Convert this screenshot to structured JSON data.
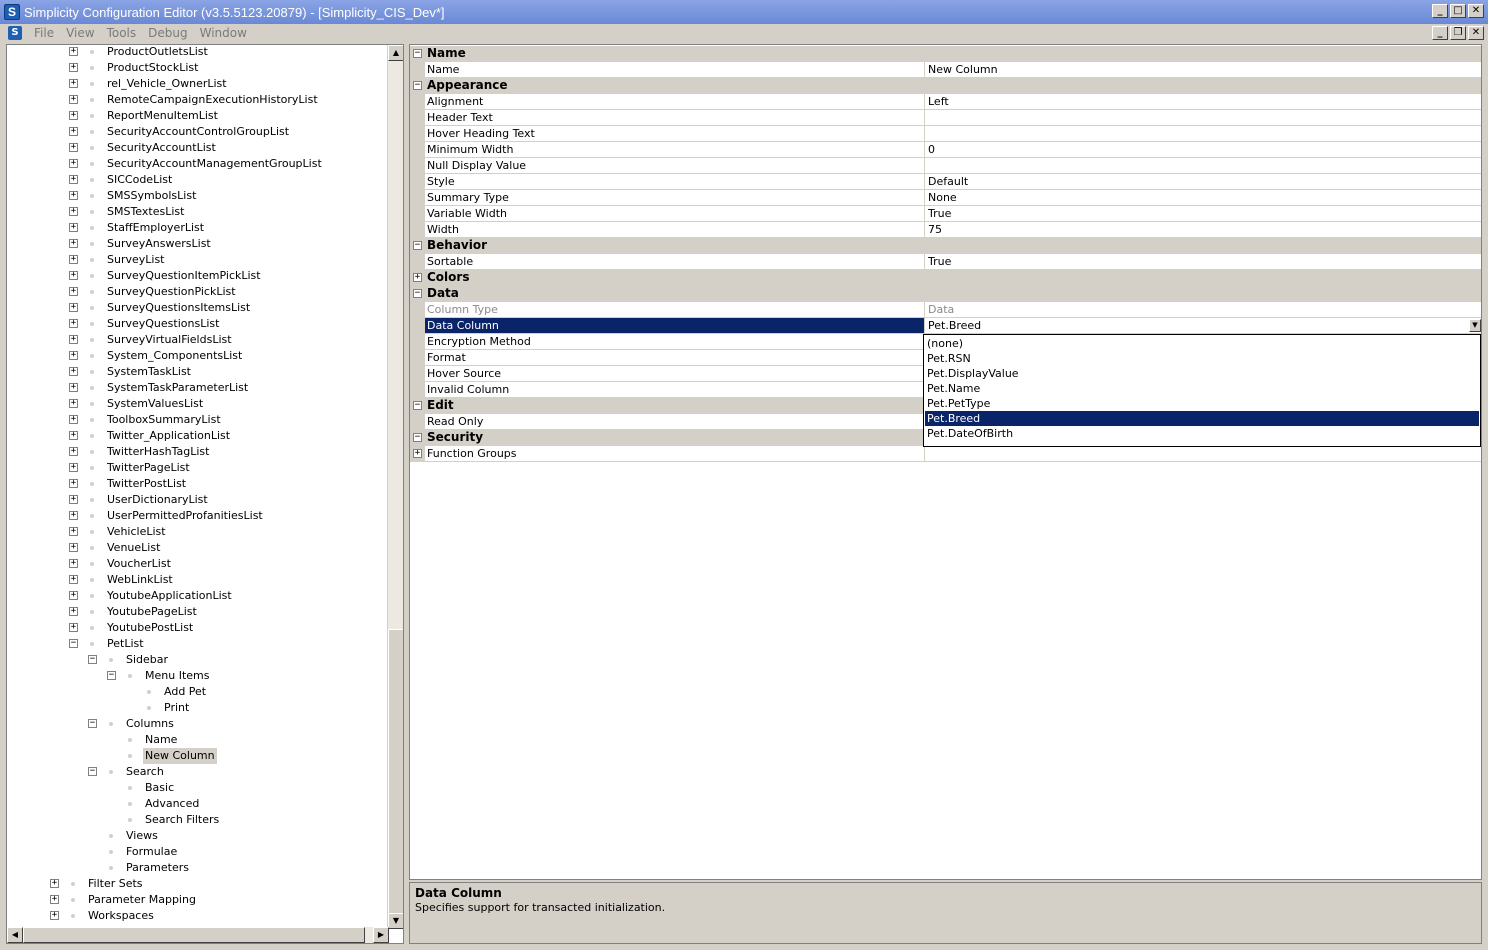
{
  "window": {
    "title": "Simplicity Configuration Editor (v3.5.5123.20879) - [Simplicity_CIS_Dev*]",
    "app_icon": "S"
  },
  "menu": [
    "File",
    "View",
    "Tools",
    "Debug",
    "Window"
  ],
  "tree": [
    {
      "label": "ProductOutletsList",
      "depth": 0,
      "toggle": "+"
    },
    {
      "label": "ProductStockList",
      "depth": 0,
      "toggle": "+"
    },
    {
      "label": "rel_Vehicle_OwnerList",
      "depth": 0,
      "toggle": "+"
    },
    {
      "label": "RemoteCampaignExecutionHistoryList",
      "depth": 0,
      "toggle": "+"
    },
    {
      "label": "ReportMenuItemList",
      "depth": 0,
      "toggle": "+"
    },
    {
      "label": "SecurityAccountControlGroupList",
      "depth": 0,
      "toggle": "+"
    },
    {
      "label": "SecurityAccountList",
      "depth": 0,
      "toggle": "+"
    },
    {
      "label": "SecurityAccountManagementGroupList",
      "depth": 0,
      "toggle": "+"
    },
    {
      "label": "SICCodeList",
      "depth": 0,
      "toggle": "+"
    },
    {
      "label": "SMSSymbolsList",
      "depth": 0,
      "toggle": "+"
    },
    {
      "label": "SMSTextesList",
      "depth": 0,
      "toggle": "+"
    },
    {
      "label": "StaffEmployerList",
      "depth": 0,
      "toggle": "+"
    },
    {
      "label": "SurveyAnswersList",
      "depth": 0,
      "toggle": "+"
    },
    {
      "label": "SurveyList",
      "depth": 0,
      "toggle": "+"
    },
    {
      "label": "SurveyQuestionItemPickList",
      "depth": 0,
      "toggle": "+"
    },
    {
      "label": "SurveyQuestionPickList",
      "depth": 0,
      "toggle": "+"
    },
    {
      "label": "SurveyQuestionsItemsList",
      "depth": 0,
      "toggle": "+"
    },
    {
      "label": "SurveyQuestionsList",
      "depth": 0,
      "toggle": "+"
    },
    {
      "label": "SurveyVirtualFieldsList",
      "depth": 0,
      "toggle": "+"
    },
    {
      "label": "System_ComponentsList",
      "depth": 0,
      "toggle": "+"
    },
    {
      "label": "SystemTaskList",
      "depth": 0,
      "toggle": "+"
    },
    {
      "label": "SystemTaskParameterList",
      "depth": 0,
      "toggle": "+"
    },
    {
      "label": "SystemValuesList",
      "depth": 0,
      "toggle": "+"
    },
    {
      "label": "ToolboxSummaryList",
      "depth": 0,
      "toggle": "+"
    },
    {
      "label": "Twitter_ApplicationList",
      "depth": 0,
      "toggle": "+"
    },
    {
      "label": "TwitterHashTagList",
      "depth": 0,
      "toggle": "+"
    },
    {
      "label": "TwitterPageList",
      "depth": 0,
      "toggle": "+"
    },
    {
      "label": "TwitterPostList",
      "depth": 0,
      "toggle": "+"
    },
    {
      "label": "UserDictionaryList",
      "depth": 0,
      "toggle": "+"
    },
    {
      "label": "UserPermittedProfanitiesList",
      "depth": 0,
      "toggle": "+"
    },
    {
      "label": "VehicleList",
      "depth": 0,
      "toggle": "+"
    },
    {
      "label": "VenueList",
      "depth": 0,
      "toggle": "+"
    },
    {
      "label": "VoucherList",
      "depth": 0,
      "toggle": "+"
    },
    {
      "label": "WebLinkList",
      "depth": 0,
      "toggle": "+"
    },
    {
      "label": "YoutubeApplicationList",
      "depth": 0,
      "toggle": "+"
    },
    {
      "label": "YoutubePageList",
      "depth": 0,
      "toggle": "+"
    },
    {
      "label": "YoutubePostList",
      "depth": 0,
      "toggle": "+"
    },
    {
      "label": "PetList",
      "depth": 0,
      "toggle": "-"
    },
    {
      "label": "Sidebar",
      "depth": 1,
      "toggle": "-"
    },
    {
      "label": "Menu Items",
      "depth": 2,
      "toggle": "-"
    },
    {
      "label": "Add Pet",
      "depth": 3,
      "toggle": ""
    },
    {
      "label": "Print",
      "depth": 3,
      "toggle": ""
    },
    {
      "label": "Columns",
      "depth": 1,
      "toggle": "-"
    },
    {
      "label": "Name",
      "depth": 2,
      "toggle": ""
    },
    {
      "label": "New Column",
      "depth": 2,
      "toggle": "",
      "selected": true
    },
    {
      "label": "Search",
      "depth": 1,
      "toggle": "-"
    },
    {
      "label": "Basic",
      "depth": 2,
      "toggle": ""
    },
    {
      "label": "Advanced",
      "depth": 2,
      "toggle": ""
    },
    {
      "label": "Search Filters",
      "depth": 2,
      "toggle": ""
    },
    {
      "label": "Views",
      "depth": 1,
      "toggle": ""
    },
    {
      "label": "Formulae",
      "depth": 1,
      "toggle": ""
    },
    {
      "label": "Parameters",
      "depth": 1,
      "toggle": ""
    },
    {
      "label": "Filter Sets",
      "depth": -1,
      "toggle": "+"
    },
    {
      "label": "Parameter Mapping",
      "depth": -1,
      "toggle": "+"
    },
    {
      "label": "Workspaces",
      "depth": -1,
      "toggle": "+"
    }
  ],
  "properties": [
    {
      "type": "category",
      "label": "Name",
      "toggle": "-"
    },
    {
      "type": "prop",
      "name": "Name",
      "value": "New Column"
    },
    {
      "type": "category",
      "label": "Appearance",
      "toggle": "-"
    },
    {
      "type": "prop",
      "name": "Alignment",
      "value": "Left"
    },
    {
      "type": "prop",
      "name": "Header Text",
      "value": ""
    },
    {
      "type": "prop",
      "name": "Hover Heading Text",
      "value": ""
    },
    {
      "type": "prop",
      "name": "Minimum Width",
      "value": "0"
    },
    {
      "type": "prop",
      "name": "Null Display Value",
      "value": ""
    },
    {
      "type": "prop",
      "name": "Style",
      "value": "Default"
    },
    {
      "type": "prop",
      "name": "Summary Type",
      "value": "None"
    },
    {
      "type": "prop",
      "name": "Variable Width",
      "value": "True"
    },
    {
      "type": "prop",
      "name": "Width",
      "value": "75"
    },
    {
      "type": "category",
      "label": "Behavior",
      "toggle": "-"
    },
    {
      "type": "prop",
      "name": "Sortable",
      "value": "True"
    },
    {
      "type": "category",
      "label": "Colors",
      "toggle": "+"
    },
    {
      "type": "category",
      "label": "Data",
      "toggle": "-"
    },
    {
      "type": "prop",
      "name": "Column Type",
      "value": "Data",
      "readonly": true
    },
    {
      "type": "prop",
      "name": "Data Column",
      "value": "Pet.Breed",
      "selected": true,
      "dropdown": true
    },
    {
      "type": "prop",
      "name": "Encryption Method",
      "value": ""
    },
    {
      "type": "prop",
      "name": "Format",
      "value": ""
    },
    {
      "type": "prop",
      "name": "Hover Source",
      "value": ""
    },
    {
      "type": "prop",
      "name": "Invalid Column",
      "value": ""
    },
    {
      "type": "category",
      "label": "Edit",
      "toggle": "-"
    },
    {
      "type": "prop",
      "name": "Read Only",
      "value": ""
    },
    {
      "type": "category",
      "label": "Security",
      "toggle": "-"
    },
    {
      "type": "prop",
      "name": "Function Groups",
      "value": "",
      "expandable": true
    }
  ],
  "dropdown": {
    "options": [
      "(none)",
      "Pet.RSN",
      "Pet.DisplayValue",
      "Pet.Name",
      "Pet.PetType",
      "Pet.Breed",
      "Pet.DateOfBirth"
    ],
    "selected": "Pet.Breed"
  },
  "description": {
    "title": "Data Column",
    "text": "Specifies support for transacted initialization."
  }
}
